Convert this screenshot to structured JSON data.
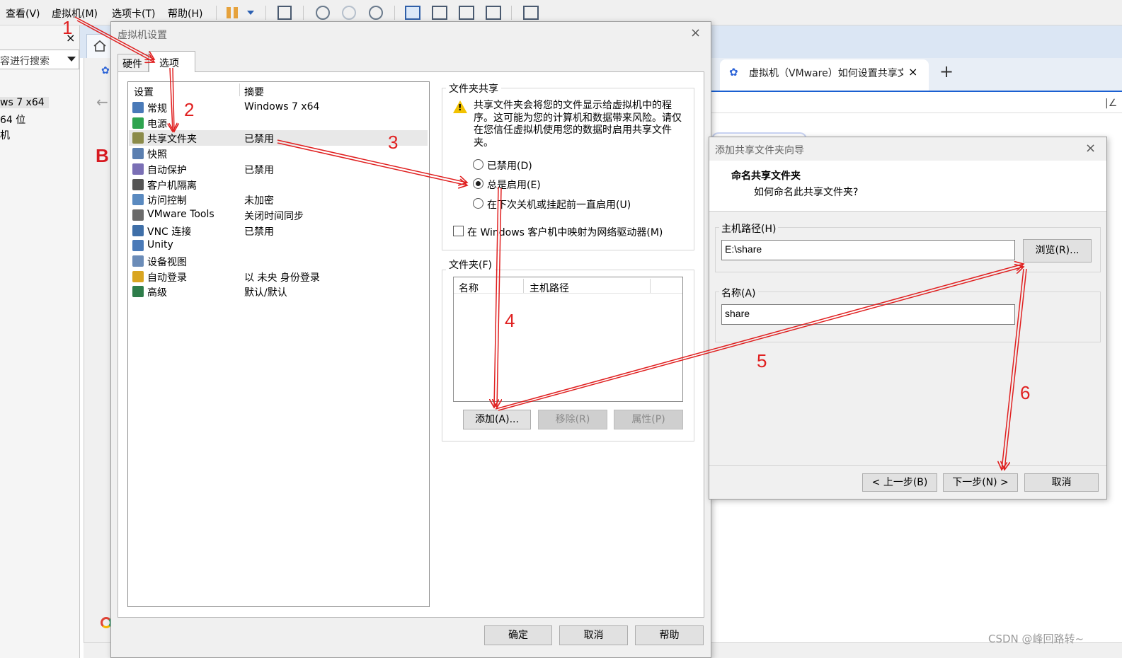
{
  "menubar": {
    "items": [
      "查看(V)",
      "虚拟机(M)",
      "选项卡(T)",
      "帮助(H)"
    ]
  },
  "left_panel": {
    "close": "×",
    "search_placeholder": "容进行搜索",
    "tree": [
      "ws 7 x64",
      " 64 位",
      "机"
    ]
  },
  "browser": {
    "left_logo": "B",
    "back": "←",
    "tab_title": "虚拟机（VMware）如何设置共享文",
    "tab_close": "×",
    "new_tab": "+",
    "addr_edge": "|∠"
  },
  "settings_dialog": {
    "title": "虚拟机设置",
    "close": "×",
    "tabs": [
      "硬件",
      "选项"
    ],
    "list_headers": [
      "设置",
      "摘要"
    ],
    "rows": [
      {
        "name": "常规",
        "summary": "Windows 7 x64",
        "icon_color": "#4a7ab8",
        "icon": "monitor-icon"
      },
      {
        "name": "电源",
        "summary": "",
        "icon_color": "#2ea44f",
        "icon": "power-play-icon"
      },
      {
        "name": "共享文件夹",
        "summary": "已禁用",
        "icon_color": "#8b8b4a",
        "icon": "shared-folder-icon"
      },
      {
        "name": "快照",
        "summary": "",
        "icon_color": "#5b7fb0",
        "icon": "snapshot-icon"
      },
      {
        "name": "自动保护",
        "summary": "已禁用",
        "icon_color": "#7a6fb5",
        "icon": "clock-shield-icon"
      },
      {
        "name": "客户机隔离",
        "summary": "",
        "icon_color": "#555555",
        "icon": "lock-icon"
      },
      {
        "name": "访问控制",
        "summary": "未加密",
        "icon_color": "#5a8ac0",
        "icon": "access-control-icon"
      },
      {
        "name": "VMware Tools",
        "summary": "关闭时间同步",
        "icon_color": "#6a6a6a",
        "icon": "vm-tools-icon"
      },
      {
        "name": "VNC 连接",
        "summary": "已禁用",
        "icon_color": "#3f6fa8",
        "icon": "vnc-monitor-icon"
      },
      {
        "name": "Unity",
        "summary": "",
        "icon_color": "#4a7ab8",
        "icon": "unity-icon"
      },
      {
        "name": "设备视图",
        "summary": "",
        "icon_color": "#6b8cb8",
        "icon": "device-view-icon"
      },
      {
        "name": "自动登录",
        "summary": "以 未央 身份登录",
        "icon_color": "#d9a520",
        "icon": "auto-login-icon"
      },
      {
        "name": "高级",
        "summary": "默认/默认",
        "icon_color": "#2e7d4a",
        "icon": "advanced-icon"
      }
    ],
    "selected_row": 2,
    "sharing": {
      "legend": "文件夹共享",
      "warning": "共享文件夹会将您的文件显示给虚拟机中的程序。这可能为您的计算机和数据带来风险。请仅在您信任虚拟机使用您的数据时启用共享文件夹。",
      "options": [
        "已禁用(D)",
        "总是启用(E)",
        "在下次关机或挂起前一直启用(U)"
      ],
      "selected": 1,
      "map_drive": "在 Windows 客户机中映射为网络驱动器(M)"
    },
    "folders": {
      "legend": "文件夹(F)",
      "columns": [
        "名称",
        "主机路径"
      ],
      "buttons": {
        "add": "添加(A)...",
        "remove": "移除(R)",
        "props": "属性(P)"
      }
    },
    "footer": {
      "ok": "确定",
      "cancel": "取消",
      "help": "帮助"
    }
  },
  "wizard": {
    "title": "添加共享文件夹向导",
    "close": "×",
    "heading": "命名共享文件夹",
    "subheading": "如何命名此共享文件夹?",
    "host_path_label": "主机路径(H)",
    "host_path_value": "E:\\share",
    "browse": "浏览(R)...",
    "name_label": "名称(A)",
    "name_value": "share",
    "back": "< 上一步(B)",
    "next": "下一步(N) >",
    "cancel": "取消"
  },
  "annotations": {
    "numbers": [
      "1",
      "2",
      "3",
      "4",
      "5",
      "6"
    ],
    "arrow_color": "#e02020"
  },
  "watermark": "CSDN @峰回路转~"
}
